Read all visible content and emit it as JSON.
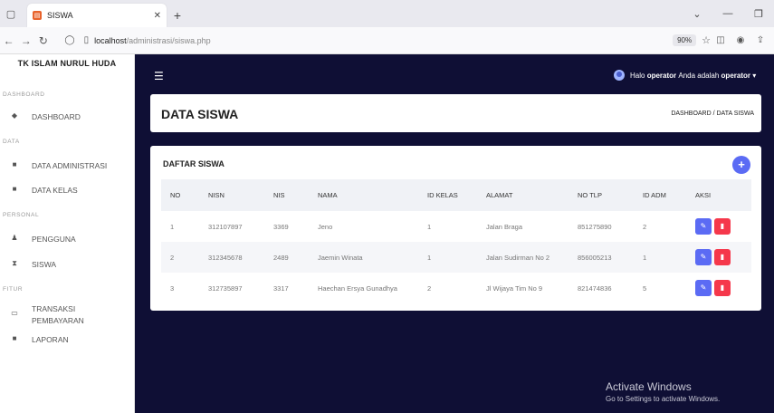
{
  "browser": {
    "tab_title": "SISWA",
    "url_host": "localhost",
    "url_path": "/administrasi/siswa.php",
    "zoom": "90%"
  },
  "sidebar": {
    "brand": "TK ISLAM NURUL HUDA",
    "sections": [
      "DASHBOARD",
      "DATA",
      "PERSONAL",
      "FITUR"
    ],
    "items": [
      {
        "label": "DASHBOARD",
        "icon": "dashboard-icon"
      },
      {
        "label": "DATA ADMINISTRASI",
        "icon": "table-icon"
      },
      {
        "label": "DATA KELAS",
        "icon": "table-icon"
      },
      {
        "label": "PENGGUNA",
        "icon": "users-icon"
      },
      {
        "label": "SISWA",
        "icon": "student-icon"
      },
      {
        "label": "TRANSAKSI PEMBAYARAN",
        "icon": "money-icon"
      },
      {
        "label": "LAPORAN",
        "icon": "report-icon"
      }
    ]
  },
  "header": {
    "greeting": "Halo",
    "user": "operator",
    "role_text": "Anda adalah",
    "role": "operator"
  },
  "page": {
    "title": "DATA SISWA",
    "breadcrumb": "DASHBOARD / DATA SISWA"
  },
  "table": {
    "title": "DAFTAR SISWA",
    "columns": [
      "NO",
      "NISN",
      "NIS",
      "NAMA",
      "ID KELAS",
      "ALAMAT",
      "NO TLP",
      "ID ADM",
      "AKSI"
    ],
    "rows": [
      [
        "1",
        "312107897",
        "3369",
        "Jeno",
        "1",
        "Jalan Braga",
        "851275890",
        "2"
      ],
      [
        "2",
        "312345678",
        "2489",
        "Jaemin Winata",
        "1",
        "Jalan Sudirman No 2",
        "856005213",
        "1"
      ],
      [
        "3",
        "312735897",
        "3317",
        "Haechan Ersya Gunadhya",
        "2",
        "Jl Wijaya Tim No 9",
        "821474836",
        "5"
      ]
    ]
  },
  "watermark": {
    "line1": "Activate Windows",
    "line2": "Go to Settings to activate Windows."
  },
  "colors": {
    "sidebar_bg": "#ffffff",
    "main_bg": "#0f0f35",
    "accent": "#5b6bf4",
    "danger": "#f5384b"
  }
}
